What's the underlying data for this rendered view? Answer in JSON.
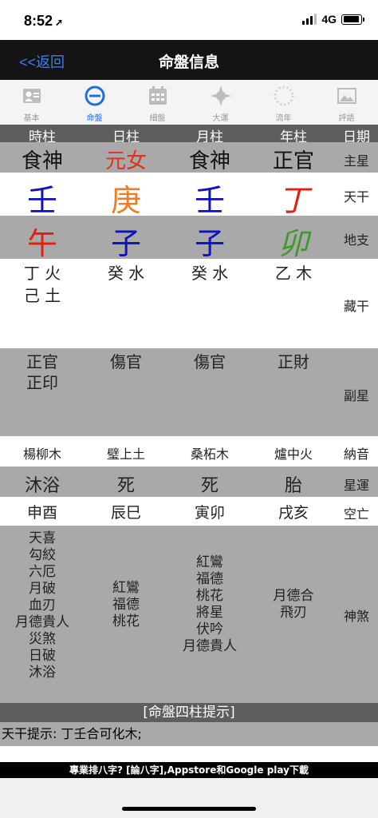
{
  "status": {
    "time": "8:52",
    "network": "4G",
    "battery_level": 0.95
  },
  "nav": {
    "back": "<<返回",
    "title": "命盤信息"
  },
  "tabs": [
    {
      "label": "基本",
      "icon": "person-card-icon",
      "active": false
    },
    {
      "label": "命盤",
      "icon": "circle-minus-icon",
      "active": true
    },
    {
      "label": "細盤",
      "icon": "calendar-grid-icon",
      "active": false
    },
    {
      "label": "大運",
      "icon": "compass-star-icon",
      "active": false
    },
    {
      "label": "流年",
      "icon": "dashed-circle-icon",
      "active": false
    },
    {
      "label": "評語",
      "icon": "landscape-image-icon",
      "active": false
    }
  ],
  "header": [
    "時柱",
    "日柱",
    "月柱",
    "年柱",
    "日期"
  ],
  "rows": {
    "zhuxing": {
      "label": "主星",
      "values": [
        "食神",
        "元女",
        "食神",
        "正官"
      ]
    },
    "tiangan": {
      "label": "天干",
      "values": [
        "壬",
        "庚",
        "壬",
        "丁"
      ]
    },
    "dizhi": {
      "label": "地支",
      "values": [
        "午",
        "子",
        "子",
        "卯"
      ]
    },
    "canggan": {
      "label": "藏干",
      "values": [
        [
          "丁 火",
          "己 土"
        ],
        [
          "癸 水"
        ],
        [
          "癸 水"
        ],
        [
          "乙 木"
        ]
      ]
    },
    "fuxing": {
      "label": "副星",
      "values": [
        [
          "正官",
          "正印"
        ],
        [
          "傷官"
        ],
        [
          "傷官"
        ],
        [
          "正財"
        ]
      ]
    },
    "nayin": {
      "label": "納音",
      "values": [
        "楊柳木",
        "璧上土",
        "桑柘木",
        "爐中火"
      ]
    },
    "xingyun": {
      "label": "星運",
      "values": [
        "沐浴",
        "死",
        "死",
        "胎"
      ]
    },
    "kongwang": {
      "label": "空亡",
      "values": [
        "申酉",
        "辰巳",
        "寅卯",
        "戌亥"
      ]
    },
    "shensha": {
      "label": "神煞",
      "values": [
        [
          "天喜",
          "勾絞",
          "六厄",
          "月破",
          "血刃",
          "月德貴人",
          "災煞",
          "日破",
          "沐浴"
        ],
        [
          "紅鸞",
          "福德",
          "桃花"
        ],
        [
          "紅鸞",
          "福德",
          "桃花",
          "將星",
          "伏吟",
          "月德貴人"
        ],
        [
          "月德合",
          "飛刃"
        ]
      ]
    }
  },
  "colors": {
    "zhuxing": [
      "#111111",
      "#e03020",
      "#111111",
      "#111111"
    ],
    "tiangan": [
      "#1010c0",
      "#f07a20",
      "#1010c0",
      "#e02010"
    ],
    "dizhi": [
      "#e02010",
      "#1010c0",
      "#1010c0",
      "#3a9a2a"
    ],
    "accent": "#1f6fde",
    "back_link": "#3d7ff0"
  },
  "footer": {
    "title": "[命盤四柱提示]",
    "hint": "天干提示: 丁壬合可化木;",
    "promo": "專業排八字? [論八字],Appstore和Google play下載"
  }
}
